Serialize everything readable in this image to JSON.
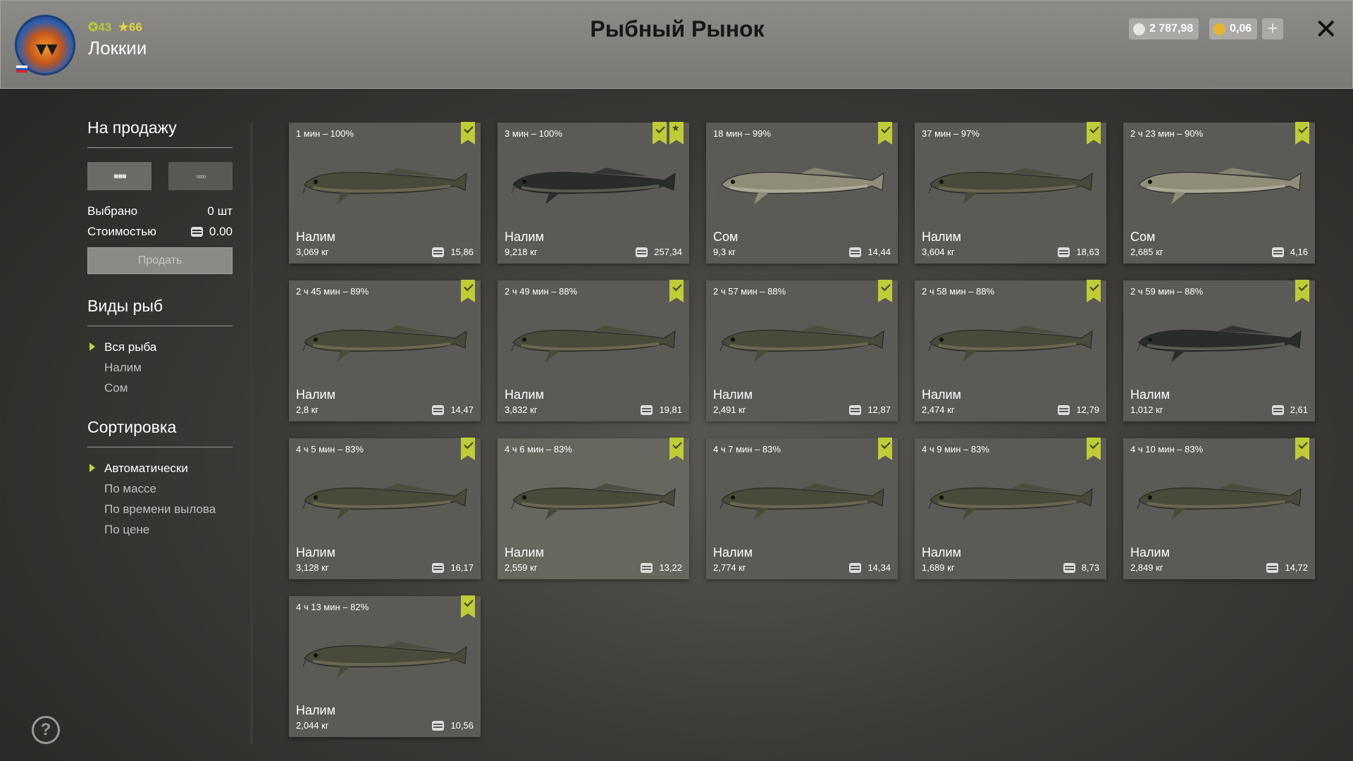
{
  "header": {
    "title": "Рыбный Рынок",
    "player_name": "Локкии",
    "level": "43",
    "rank": "66",
    "silver": "2 787,98",
    "gold": "0,06",
    "add_label": "+",
    "close_label": "✕"
  },
  "sidebar": {
    "sale_title": "На продажу",
    "selected_label": "Выбрано",
    "selected_value": "0 шт",
    "cost_label": "Стоимостью",
    "cost_value": "0.00",
    "sell_button": "Продать",
    "species_title": "Виды рыб",
    "species": [
      "Вся рыба",
      "Налим",
      "Сом"
    ],
    "sort_title": "Сортировка",
    "sort_options": [
      "Автоматически",
      "По массе",
      "По времени вылова",
      "По цене"
    ],
    "help": "?"
  },
  "fish": [
    {
      "time": "1 мин – 100%",
      "name": "Налим",
      "weight": "3,069 кг",
      "price": "15,86",
      "star": false
    },
    {
      "time": "3 мин – 100%",
      "name": "Налим",
      "weight": "9,218 кг",
      "price": "257,34",
      "star": true
    },
    {
      "time": "18 мин – 99%",
      "name": "Сом",
      "weight": "9,3 кг",
      "price": "14,44",
      "star": false
    },
    {
      "time": "37 мин – 97%",
      "name": "Налим",
      "weight": "3,604 кг",
      "price": "18,63",
      "star": false
    },
    {
      "time": "2 ч 23 мин – 90%",
      "name": "Сом",
      "weight": "2,685 кг",
      "price": "4,16",
      "star": false
    },
    {
      "time": "2 ч 45 мин – 89%",
      "name": "Налим",
      "weight": "2,8 кг",
      "price": "14,47",
      "star": false
    },
    {
      "time": "2 ч 49 мин – 88%",
      "name": "Налим",
      "weight": "3,832 кг",
      "price": "19,81",
      "star": false
    },
    {
      "time": "2 ч 57 мин – 88%",
      "name": "Налим",
      "weight": "2,491 кг",
      "price": "12,87",
      "star": false
    },
    {
      "time": "2 ч 58 мин – 88%",
      "name": "Налим",
      "weight": "2,474 кг",
      "price": "12,79",
      "star": false
    },
    {
      "time": "2 ч 59 мин – 88%",
      "name": "Налим",
      "weight": "1,012 кг",
      "price": "2,61",
      "star": false
    },
    {
      "time": "4 ч 5 мин – 83%",
      "name": "Налим",
      "weight": "3,128 кг",
      "price": "16,17",
      "star": false
    },
    {
      "time": "4 ч 6 мин – 83%",
      "name": "Налим",
      "weight": "2,559 кг",
      "price": "13,22",
      "star": false
    },
    {
      "time": "4 ч 7 мин – 83%",
      "name": "Налим",
      "weight": "2,774 кг",
      "price": "14,34",
      "star": false
    },
    {
      "time": "4 ч 9 мин – 83%",
      "name": "Налим",
      "weight": "1,689 кг",
      "price": "8,73",
      "star": false
    },
    {
      "time": "4 ч 10 мин – 83%",
      "name": "Налим",
      "weight": "2,849 кг",
      "price": "14,72",
      "star": false
    },
    {
      "time": "4 ч 13 мин – 82%",
      "name": "Налим",
      "weight": "2,044 кг",
      "price": "10,56",
      "star": false
    }
  ],
  "colors": {
    "accent": "#bfcc36",
    "header_bg": "#8c8b87"
  }
}
